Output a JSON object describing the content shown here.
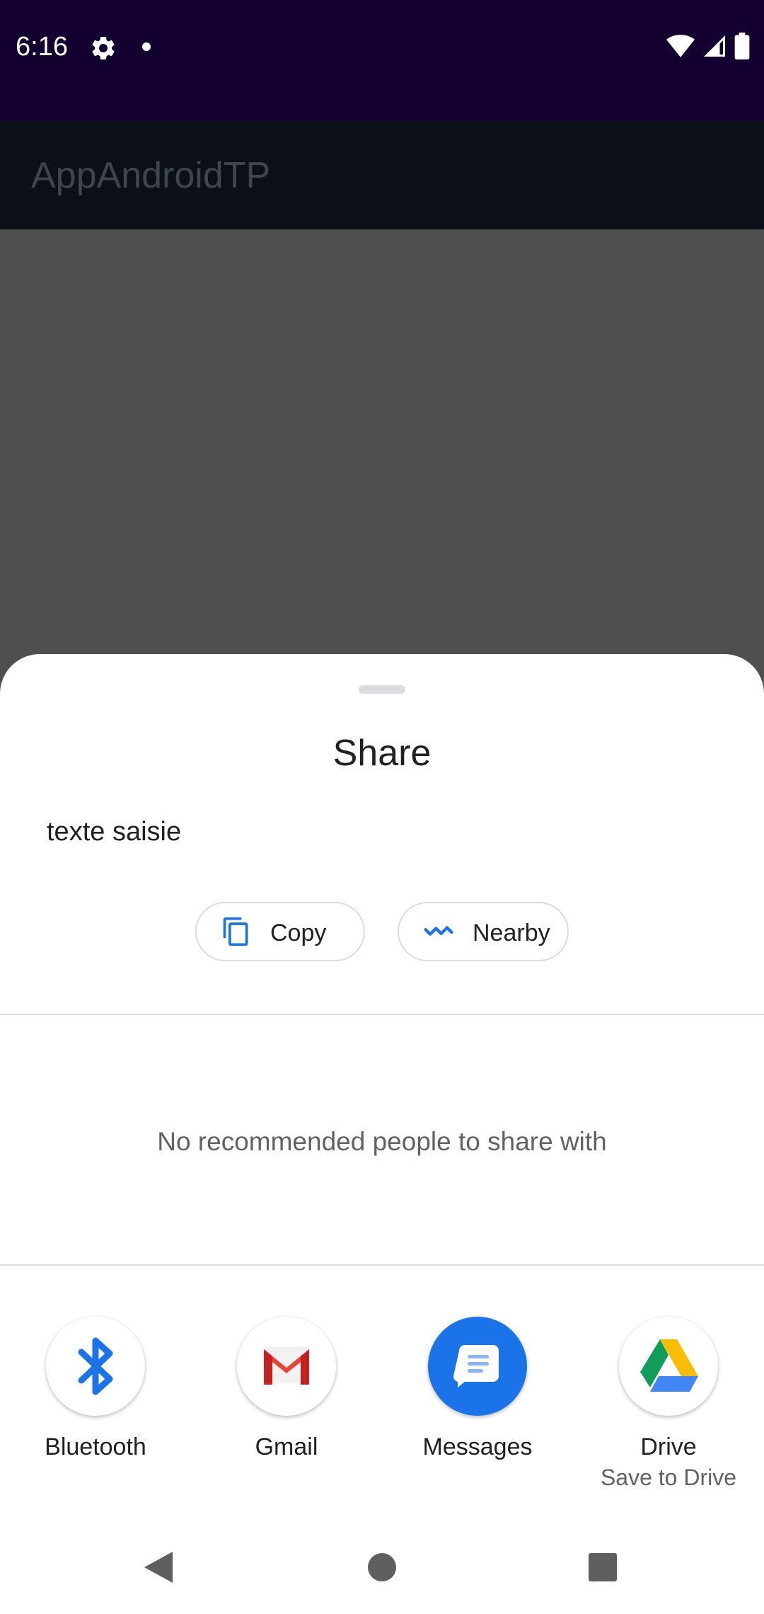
{
  "status_bar": {
    "time": "6:16",
    "icons": [
      "gear-icon",
      "notification-dot-icon",
      "wifi-icon",
      "cell-signal-icon",
      "battery-icon"
    ]
  },
  "app_bar": {
    "title": "AppAndroidTP"
  },
  "share_sheet": {
    "title": "Share",
    "shared_text": "texte saisie",
    "actions": [
      {
        "label": "Copy",
        "icon": "copy-icon"
      },
      {
        "label": "Nearby",
        "icon": "nearby-icon"
      }
    ],
    "empty_message": "No recommended people to share with",
    "targets": [
      {
        "label": "Bluetooth",
        "subtitle": "",
        "icon": "bluetooth-icon"
      },
      {
        "label": "Gmail",
        "subtitle": "",
        "icon": "gmail-icon"
      },
      {
        "label": "Messages",
        "subtitle": "",
        "icon": "messages-icon"
      },
      {
        "label": "Drive",
        "subtitle": "Save to Drive",
        "icon": "drive-icon"
      }
    ]
  },
  "nav_bar": {
    "buttons": [
      "back-icon",
      "home-icon",
      "recents-icon"
    ]
  },
  "colors": {
    "status_bar_bg": "#130030",
    "app_bar_bg": "#0b0f17",
    "scrim": "#4f4f4f",
    "accent_blue": "#1a73e8",
    "text_primary": "#202124",
    "text_secondary": "#5f6368"
  }
}
